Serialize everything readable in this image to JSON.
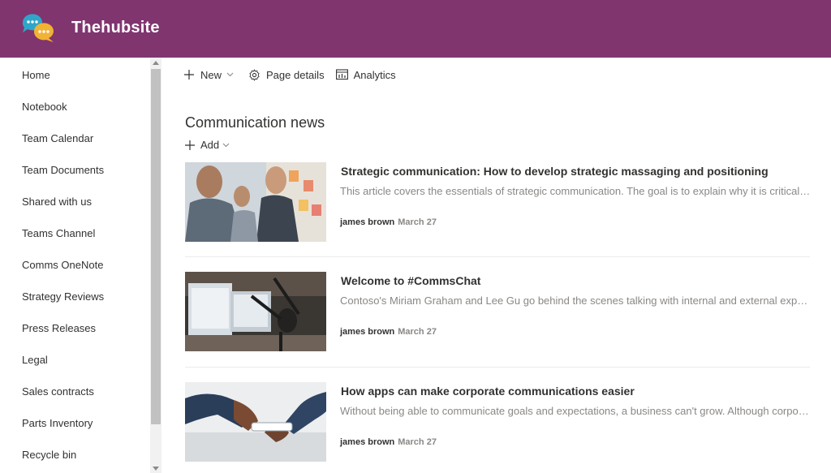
{
  "header": {
    "site_title": "Thehubsite",
    "logo_icon": "chat-bubbles-logo",
    "bg_color": "#80356f"
  },
  "nav": {
    "items": [
      {
        "label": "Home"
      },
      {
        "label": "Notebook"
      },
      {
        "label": "Team Calendar"
      },
      {
        "label": "Team Documents"
      },
      {
        "label": "Shared with us"
      },
      {
        "label": "Teams Channel"
      },
      {
        "label": "Comms OneNote"
      },
      {
        "label": "Strategy Reviews"
      },
      {
        "label": "Press Releases"
      },
      {
        "label": "Legal"
      },
      {
        "label": "Sales contracts"
      },
      {
        "label": "Parts Inventory"
      },
      {
        "label": "Recycle bin"
      }
    ]
  },
  "toolbar": {
    "new_label": "New",
    "page_details_label": "Page details",
    "analytics_label": "Analytics"
  },
  "news_section": {
    "title": "Communication news",
    "add_label": "Add",
    "items": [
      {
        "title": "Strategic communication: How to develop strategic massaging and positioning",
        "description": "This article covers the essentials of strategic communication. The goal is to explain why it is critical that...",
        "author": "james brown",
        "date": "March 27"
      },
      {
        "title": "Welcome to #CommsChat",
        "description": "Contoso's Miriam Graham and Lee Gu go behind the scenes talking with internal and external experts to...",
        "author": "james brown",
        "date": "March 27"
      },
      {
        "title": "How apps can make corporate communications easier",
        "description": "Without being able to communicate goals and expectations, a business can't grow. Although corporate...",
        "author": "james brown",
        "date": "March 27"
      }
    ]
  }
}
